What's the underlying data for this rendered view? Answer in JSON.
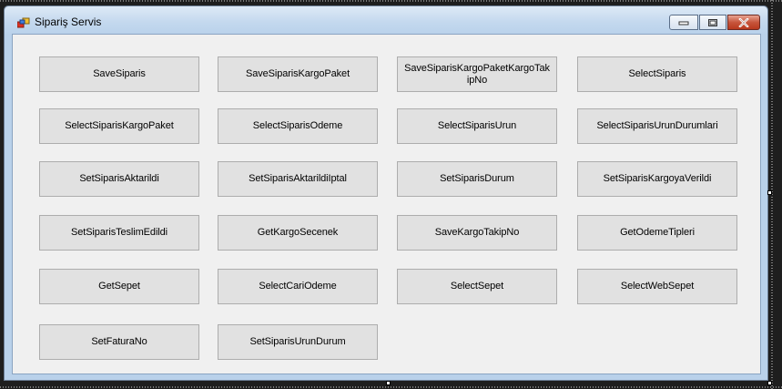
{
  "window": {
    "title": "Sipariş Servis"
  },
  "buttons": [
    "SaveSiparis",
    "SaveSiparisKargoPaket",
    "SaveSiparisKargoPaketKargoTakipNo",
    "SelectSiparis",
    "SelectSiparisKargoPaket",
    "SelectSiparisOdeme",
    "SelectSiparisUrun",
    "SelectSiparisUrunDurumlari",
    "SetSiparisAktarildi",
    "SetSiparisAktarildiIptal",
    "SetSiparisDurum",
    "SetSiparisKargoyaVerildi",
    "SetSiparisTeslimEdildi",
    "GetKargoSecenek",
    "SaveKargoTakipNo",
    "GetOdemeTipleri",
    "GetSepet",
    "SelectCariOdeme",
    "SelectSepet",
    "SelectWebSepet",
    "SetFaturaNo",
    "SetSiparisUrunDurum"
  ]
}
